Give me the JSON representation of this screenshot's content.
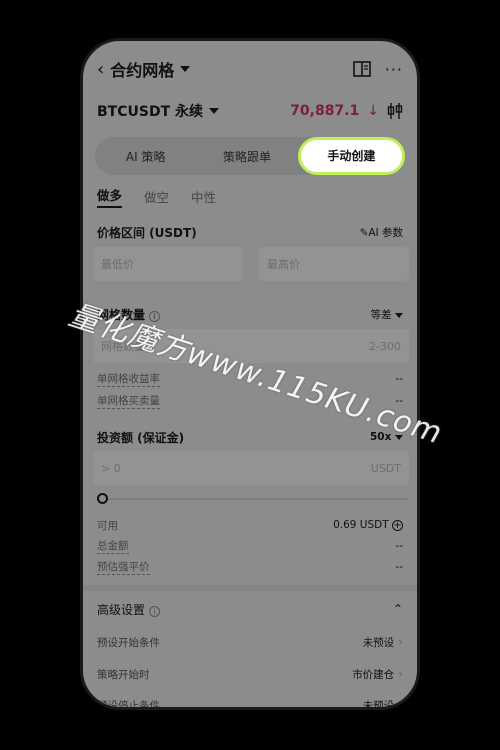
{
  "header": {
    "title": "合约网格"
  },
  "pair": {
    "name": "BTCUSDT 永续",
    "price": "70,887.1",
    "price_arrow": "↓",
    "price_color": "#7a1e3b"
  },
  "tabs": [
    {
      "label": "AI 策略"
    },
    {
      "label": "策略跟单"
    },
    {
      "label": "手动创建"
    }
  ],
  "subtabs": [
    {
      "label": "做多"
    },
    {
      "label": "做空"
    },
    {
      "label": "中性"
    }
  ],
  "price_range": {
    "label": "价格区间 (USDT)",
    "ai_params": "AI 参数",
    "min_placeholder": "最低价",
    "max_placeholder": "最高价",
    "separator": "-"
  },
  "grid_count": {
    "label": "网格数量",
    "mode": "等差",
    "placeholder": "网格数量",
    "range": "2-300"
  },
  "per_grid_yield": {
    "label": "单网格收益率",
    "value": "--"
  },
  "per_grid_amount": {
    "label": "单网格买卖量",
    "value": "--"
  },
  "investment": {
    "label": "投资额 (保证金)",
    "leverage": "50x",
    "placeholder": "> 0",
    "unit": "USDT"
  },
  "available": {
    "label": "可用",
    "value": "0.69 USDT"
  },
  "total_amount": {
    "label": "总金额",
    "value": "--"
  },
  "est_liq": {
    "label": "预估强平价",
    "value": "--"
  },
  "advanced": {
    "label": "高级设置"
  },
  "preset_start": {
    "label": "预设开始条件",
    "value": "未预设"
  },
  "strategy_start": {
    "label": "策略开始时",
    "value": "市价建仓"
  },
  "preset_stop": {
    "label": "预设停止条件",
    "value": "未预设"
  },
  "watermark": "量化魔方www.115KU.com",
  "colors": {
    "accent": "#bff05a",
    "background": "#000000"
  }
}
